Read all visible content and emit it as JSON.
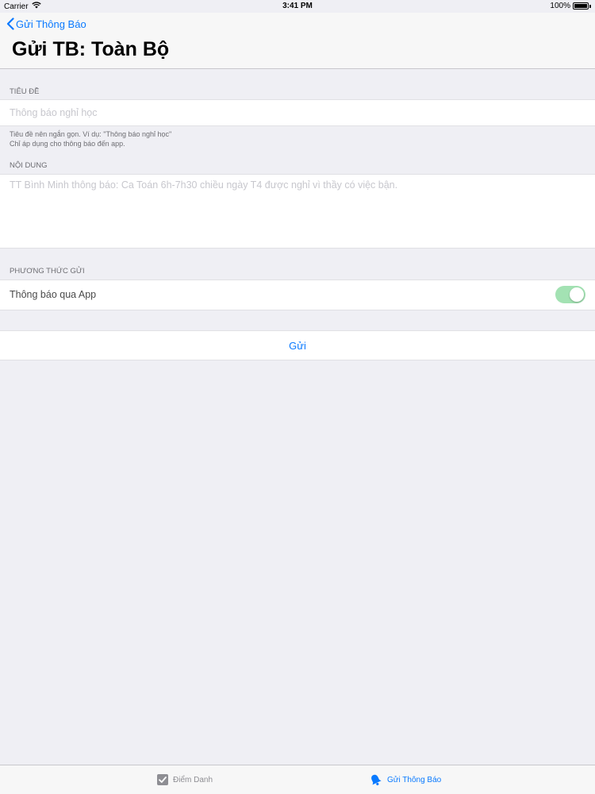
{
  "status_bar": {
    "carrier": "Carrier",
    "time": "3:41 PM",
    "battery": "100%",
    "battery_level": 1.0
  },
  "nav": {
    "back_label": "Gửi Thông Báo",
    "title": "Gửi TB: Toàn Bộ"
  },
  "form": {
    "title_section_header": "TIÊU ĐỀ",
    "title_value": "",
    "title_placeholder": "Thông báo nghỉ học",
    "title_note_line1": "Tiêu đề nên ngắn gọn. Ví dụ: \"Thông báo nghỉ học\"",
    "title_note_line2": "Chỉ áp dụng cho thông báo đến app.",
    "content_section_header": "NỘI DUNG",
    "content_value": "",
    "content_placeholder": "TT Bình Minh thông báo: Ca Toán 6h-7h30 chiều ngày T4 được nghỉ vì thầy có việc bận.",
    "method_section_header": "PHƯƠNG THỨC GỬI",
    "method_app_label": "Thông báo qua App",
    "method_app_enabled": true,
    "send_label": "Gửi"
  },
  "tab_bar": {
    "tabs": [
      {
        "label": "Điểm Danh",
        "icon": "checkbox-icon",
        "selected": false
      },
      {
        "label": "Gửi Thông Báo",
        "icon": "bell-icon",
        "selected": true
      }
    ]
  },
  "colors": {
    "accent": "#0a7aff",
    "toggle_on": "#a3e2b3",
    "background": "#efeff4",
    "tab_inactive": "#8e8e93"
  }
}
